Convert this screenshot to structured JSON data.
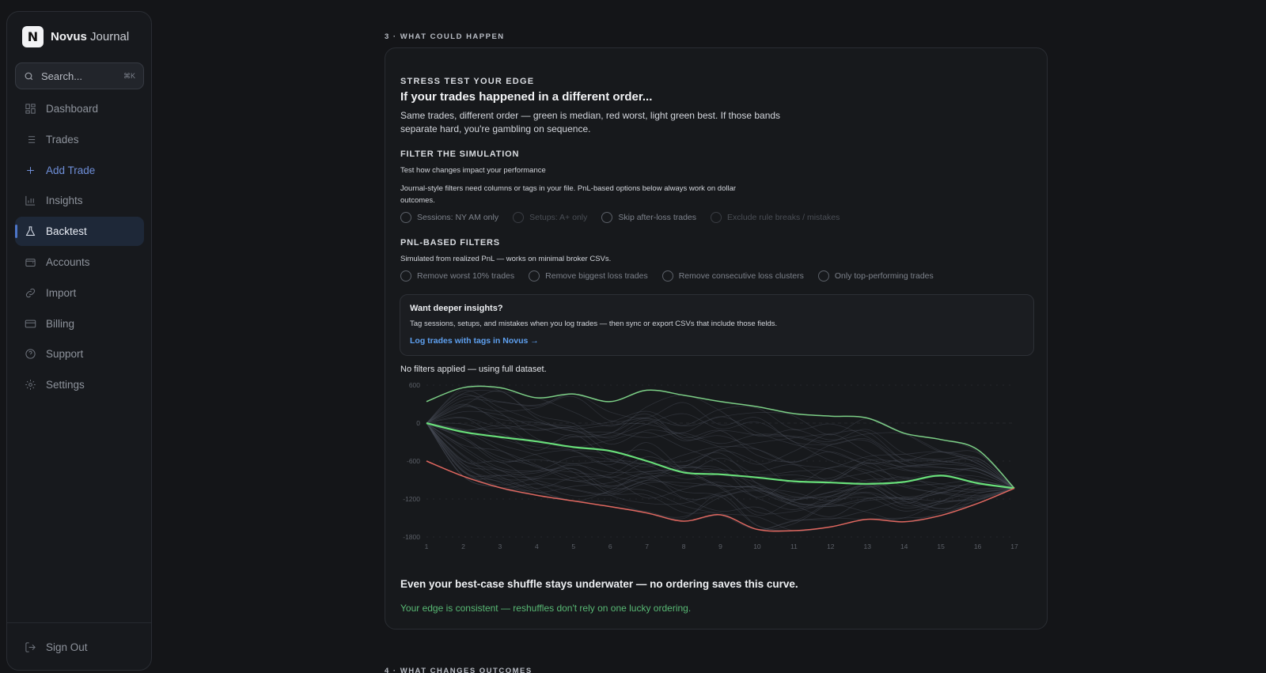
{
  "brand": {
    "logo_letter": "N",
    "name_bold": "Novus",
    "name_light": "Journal"
  },
  "search": {
    "placeholder": "Search...",
    "shortcut": "⌘K"
  },
  "nav": [
    {
      "label": "Dashboard",
      "icon": "grid-icon"
    },
    {
      "label": "Trades",
      "icon": "list-icon"
    },
    {
      "label": "Add Trade",
      "icon": "plus-icon"
    },
    {
      "label": "Insights",
      "icon": "bar-chart-icon"
    },
    {
      "label": "Backtest",
      "icon": "flask-icon"
    },
    {
      "label": "Accounts",
      "icon": "wallet-icon"
    },
    {
      "label": "Import",
      "icon": "link-icon"
    },
    {
      "label": "Billing",
      "icon": "credit-card-icon"
    },
    {
      "label": "Support",
      "icon": "help-circle-icon"
    },
    {
      "label": "Settings",
      "icon": "gear-icon"
    }
  ],
  "signout": {
    "label": "Sign Out",
    "icon": "logout-icon"
  },
  "section3": {
    "label": "3 · WHAT COULD HAPPEN"
  },
  "section4": {
    "label": "4 · WHAT CHANGES OUTCOMES"
  },
  "card": {
    "eyebrow": "STRESS TEST YOUR EDGE",
    "title": "If your trades happened in a different order...",
    "description": "Same trades, different order — green is median, red worst, light green best. If those bands separate hard, you're gambling on sequence.",
    "filter_heading": "FILTER THE SIMULATION",
    "filter_sub": "Test how changes impact your performance",
    "filter_note": "Journal-style filters need columns or tags in your file. PnL-based options below always work on dollar outcomes.",
    "journal_options": [
      "Sessions: NY AM only",
      "Setups: A+ only",
      "Skip after-loss trades",
      "Exclude rule breaks / mistakes"
    ],
    "pnl_heading": "PNL-BASED FILTERS",
    "pnl_sub": "Simulated from realized PnL — works on minimal broker CSVs.",
    "pnl_options": [
      "Remove worst 10% trades",
      "Remove biggest loss trades",
      "Remove consecutive loss clusters",
      "Only top-performing trades"
    ],
    "callout": {
      "heading": "Want deeper insights?",
      "text": "Tag sessions, setups, and mistakes when you log trades — then sync or export CSVs that include those fields.",
      "link": "Log trades with tags in Novus →"
    },
    "status": "No filters applied — using full dataset.",
    "verdict": "Even your best-case shuffle stays underwater — no ordering saves this curve.",
    "edge_note": "Your edge is consistent — reshuffles don't rely on one lucky ordering."
  },
  "chart_data": {
    "type": "line",
    "x": [
      1,
      2,
      3,
      4,
      5,
      6,
      7,
      8,
      9,
      10,
      11,
      12,
      13,
      14,
      15,
      16,
      17
    ],
    "y_ticks": [
      600,
      0,
      -600,
      -1200,
      -1800
    ],
    "ylim": [
      -1800,
      600
    ],
    "grid": true,
    "colors": {
      "best": "#7ccf86",
      "median": "#69e07a",
      "worst": "#e0675f",
      "sample": "#4a4e58"
    },
    "series": [
      {
        "role": "best",
        "values": [
          340,
          560,
          560,
          400,
          460,
          340,
          520,
          440,
          340,
          260,
          150,
          110,
          80,
          -160,
          -260,
          -420,
          -1030
        ]
      },
      {
        "role": "median",
        "values": [
          0,
          -140,
          -220,
          -290,
          -380,
          -440,
          -600,
          -780,
          -810,
          -860,
          -920,
          -940,
          -960,
          -930,
          -830,
          -950,
          -1030
        ]
      },
      {
        "role": "worst",
        "values": [
          -600,
          -840,
          -1020,
          -1140,
          -1230,
          -1320,
          -1420,
          -1550,
          -1450,
          -1680,
          -1700,
          -1640,
          -1520,
          -1560,
          -1460,
          -1270,
          -1030
        ]
      }
    ]
  }
}
